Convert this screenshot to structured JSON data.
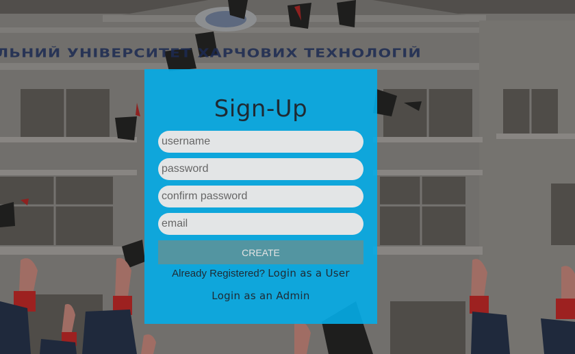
{
  "background": {
    "banner_text": "ЛЬНИЙ УНІВЕРСИТЕТ ХАРЧОВИХ ТЕХНОЛОГІЙ",
    "tint_color": "#6e6a66"
  },
  "card": {
    "color": "#04ace8",
    "title": "Sign-Up"
  },
  "form": {
    "username_placeholder": "username",
    "password_placeholder": "password",
    "confirm_password_placeholder": "confirm password",
    "email_placeholder": "email",
    "create_label": "CREATE"
  },
  "links": {
    "already_registered": "Already Registered?",
    "login_user": "Login as a User",
    "login_admin": "Login as an Admin"
  }
}
